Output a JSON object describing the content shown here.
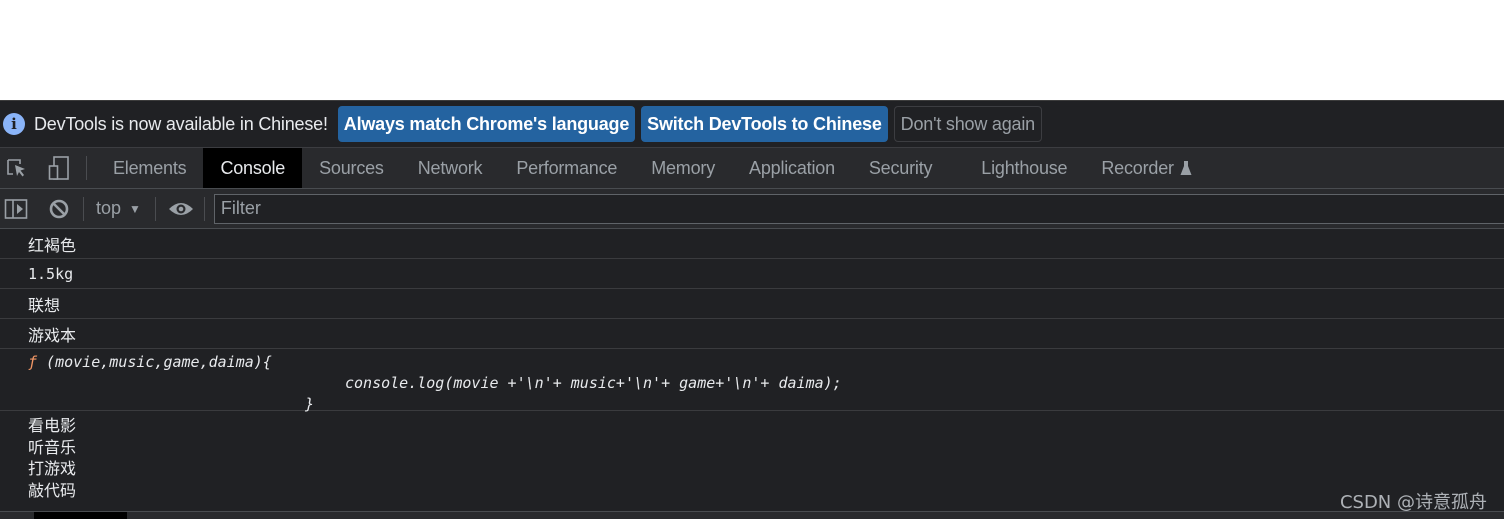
{
  "infobar": {
    "icon": "info-icon",
    "message": "DevTools is now available in Chinese!",
    "buttons": {
      "match_language": "Always match Chrome's language",
      "switch_chinese": "Switch DevTools to Chinese",
      "dont_show": "Don't show again"
    }
  },
  "tabbar": {
    "tools": [
      "inspect-element-icon",
      "device-toolbar-icon"
    ],
    "tabs": [
      {
        "label": "Elements",
        "active": false
      },
      {
        "label": "Console",
        "active": true
      },
      {
        "label": "Sources",
        "active": false
      },
      {
        "label": "Network",
        "active": false
      },
      {
        "label": "Performance",
        "active": false
      },
      {
        "label": "Memory",
        "active": false
      },
      {
        "label": "Application",
        "active": false
      },
      {
        "label": "Security",
        "active": false
      },
      {
        "label": "Lighthouse",
        "active": false
      },
      {
        "label": "Recorder",
        "active": false,
        "icon": "flask-icon"
      }
    ]
  },
  "console_toolbar": {
    "context": "top",
    "filter_placeholder": "Filter",
    "filter_value": ""
  },
  "console": {
    "messages": [
      "红褐色",
      "1.5kg",
      "联想",
      "游戏本"
    ],
    "function": {
      "prefix": "ƒ",
      "signature": " (movie,music,game,daima){",
      "body": "console.log(movie +'\\n'+ music+'\\n'+ game+'\\n'+ daima);",
      "close": "}"
    },
    "multiline": [
      "看电影",
      "听音乐",
      "打游戏",
      "敲代码"
    ]
  },
  "watermark": "CSDN @诗意孤舟",
  "colors": {
    "accent_button": "#2463a0",
    "panel_bg": "#202124",
    "toolbar_bg": "#292a2d",
    "function_keyword": "#f29766",
    "info_icon": "#8ab4f8"
  }
}
